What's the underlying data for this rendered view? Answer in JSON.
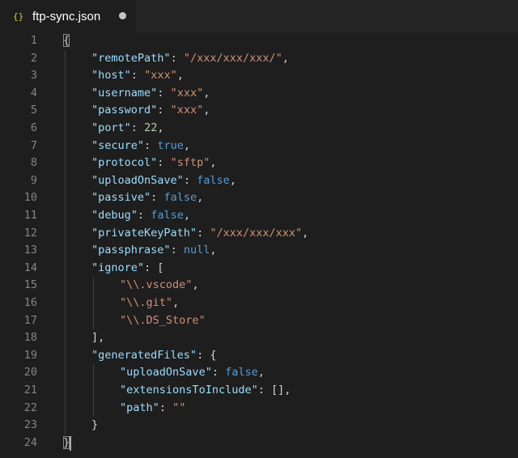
{
  "tab": {
    "icon_glyph": "{}",
    "title": "ftp-sync.json",
    "unsaved": true
  },
  "editor": {
    "lines": [
      {
        "n": "1",
        "indent": 0,
        "tokens": [
          {
            "t": "p",
            "v": "{"
          }
        ],
        "hl": true
      },
      {
        "n": "2",
        "indent": 1,
        "tokens": [
          {
            "t": "k",
            "v": "\"remotePath\""
          },
          {
            "t": "p",
            "v": ": "
          },
          {
            "t": "s",
            "v": "\"/xxx/xxx/xxx/\""
          },
          {
            "t": "p",
            "v": ","
          }
        ]
      },
      {
        "n": "3",
        "indent": 1,
        "tokens": [
          {
            "t": "k",
            "v": "\"host\""
          },
          {
            "t": "p",
            "v": ": "
          },
          {
            "t": "s",
            "v": "\"xxx\""
          },
          {
            "t": "p",
            "v": ","
          }
        ]
      },
      {
        "n": "4",
        "indent": 1,
        "tokens": [
          {
            "t": "k",
            "v": "\"username\""
          },
          {
            "t": "p",
            "v": ": "
          },
          {
            "t": "s",
            "v": "\"xxx\""
          },
          {
            "t": "p",
            "v": ","
          }
        ]
      },
      {
        "n": "5",
        "indent": 1,
        "tokens": [
          {
            "t": "k",
            "v": "\"password\""
          },
          {
            "t": "p",
            "v": ": "
          },
          {
            "t": "s",
            "v": "\"xxx\""
          },
          {
            "t": "p",
            "v": ","
          }
        ]
      },
      {
        "n": "6",
        "indent": 1,
        "tokens": [
          {
            "t": "k",
            "v": "\"port\""
          },
          {
            "t": "p",
            "v": ": "
          },
          {
            "t": "n",
            "v": "22"
          },
          {
            "t": "p",
            "v": ","
          }
        ]
      },
      {
        "n": "7",
        "indent": 1,
        "tokens": [
          {
            "t": "k",
            "v": "\"secure\""
          },
          {
            "t": "p",
            "v": ": "
          },
          {
            "t": "b",
            "v": "true"
          },
          {
            "t": "p",
            "v": ","
          }
        ]
      },
      {
        "n": "8",
        "indent": 1,
        "tokens": [
          {
            "t": "k",
            "v": "\"protocol\""
          },
          {
            "t": "p",
            "v": ": "
          },
          {
            "t": "s",
            "v": "\"sftp\""
          },
          {
            "t": "p",
            "v": ","
          }
        ]
      },
      {
        "n": "9",
        "indent": 1,
        "tokens": [
          {
            "t": "k",
            "v": "\"uploadOnSave\""
          },
          {
            "t": "p",
            "v": ": "
          },
          {
            "t": "b",
            "v": "false"
          },
          {
            "t": "p",
            "v": ","
          }
        ]
      },
      {
        "n": "10",
        "indent": 1,
        "tokens": [
          {
            "t": "k",
            "v": "\"passive\""
          },
          {
            "t": "p",
            "v": ": "
          },
          {
            "t": "b",
            "v": "false"
          },
          {
            "t": "p",
            "v": ","
          }
        ]
      },
      {
        "n": "11",
        "indent": 1,
        "tokens": [
          {
            "t": "k",
            "v": "\"debug\""
          },
          {
            "t": "p",
            "v": ": "
          },
          {
            "t": "b",
            "v": "false"
          },
          {
            "t": "p",
            "v": ","
          }
        ]
      },
      {
        "n": "12",
        "indent": 1,
        "tokens": [
          {
            "t": "k",
            "v": "\"privateKeyPath\""
          },
          {
            "t": "p",
            "v": ": "
          },
          {
            "t": "s",
            "v": "\"/xxx/xxx/xxx\""
          },
          {
            "t": "p",
            "v": ","
          }
        ]
      },
      {
        "n": "13",
        "indent": 1,
        "tokens": [
          {
            "t": "k",
            "v": "\"passphrase\""
          },
          {
            "t": "p",
            "v": ": "
          },
          {
            "t": "b",
            "v": "null"
          },
          {
            "t": "p",
            "v": ","
          }
        ]
      },
      {
        "n": "14",
        "indent": 1,
        "tokens": [
          {
            "t": "k",
            "v": "\"ignore\""
          },
          {
            "t": "p",
            "v": ": ["
          }
        ]
      },
      {
        "n": "15",
        "indent": 2,
        "tokens": [
          {
            "t": "s",
            "v": "\"\\\\.vscode\""
          },
          {
            "t": "p",
            "v": ","
          }
        ]
      },
      {
        "n": "16",
        "indent": 2,
        "tokens": [
          {
            "t": "s",
            "v": "\"\\\\.git\""
          },
          {
            "t": "p",
            "v": ","
          }
        ]
      },
      {
        "n": "17",
        "indent": 2,
        "tokens": [
          {
            "t": "s",
            "v": "\"\\\\.DS_Store\""
          }
        ]
      },
      {
        "n": "18",
        "indent": 1,
        "tokens": [
          {
            "t": "p",
            "v": "],"
          }
        ]
      },
      {
        "n": "19",
        "indent": 1,
        "tokens": [
          {
            "t": "k",
            "v": "\"generatedFiles\""
          },
          {
            "t": "p",
            "v": ": {"
          }
        ]
      },
      {
        "n": "20",
        "indent": 2,
        "tokens": [
          {
            "t": "k",
            "v": "\"uploadOnSave\""
          },
          {
            "t": "p",
            "v": ": "
          },
          {
            "t": "b",
            "v": "false"
          },
          {
            "t": "p",
            "v": ","
          }
        ]
      },
      {
        "n": "21",
        "indent": 2,
        "tokens": [
          {
            "t": "k",
            "v": "\"extensionsToInclude\""
          },
          {
            "t": "p",
            "v": ": [],"
          }
        ]
      },
      {
        "n": "22",
        "indent": 2,
        "tokens": [
          {
            "t": "k",
            "v": "\"path\""
          },
          {
            "t": "p",
            "v": ": "
          },
          {
            "t": "s",
            "v": "\"\""
          }
        ]
      },
      {
        "n": "23",
        "indent": 1,
        "tokens": [
          {
            "t": "p",
            "v": "}"
          }
        ]
      },
      {
        "n": "24",
        "indent": 0,
        "tokens": [
          {
            "t": "p",
            "v": "}"
          }
        ],
        "hl": true,
        "cursor": true
      }
    ]
  },
  "colors": {
    "key": "#9cdcfe",
    "string": "#ce9178",
    "number": "#b5cea8",
    "keyword": "#569cd6",
    "punctuation": "#d4d4d4",
    "line_number": "#858585",
    "background": "#1e1e1e"
  }
}
